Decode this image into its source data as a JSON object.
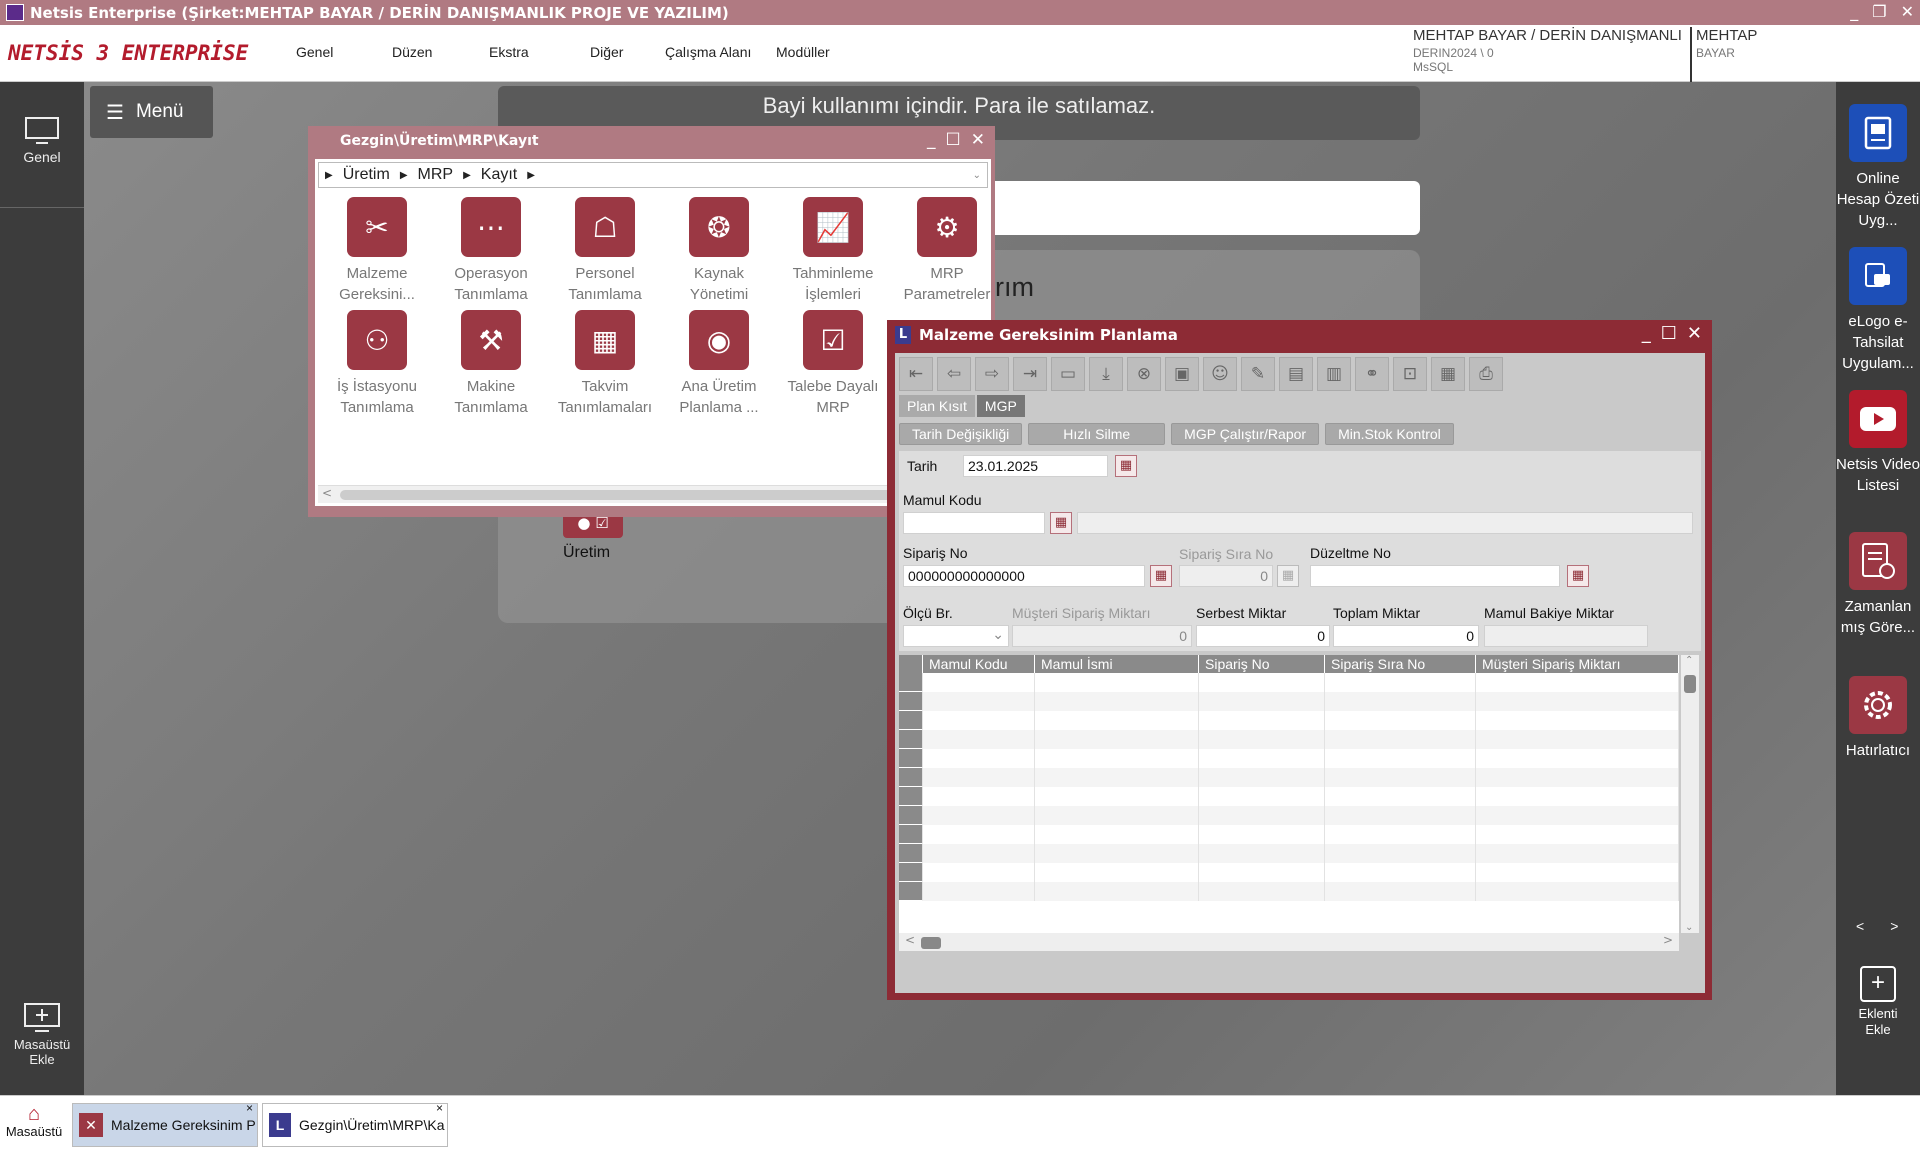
{
  "window": {
    "title": "Netsis Enterprise (Şirket:MEHTAP BAYAR / DERİN DANIŞMANLIK PROJE VE YAZILIM)",
    "minimize": "_",
    "maximize": "❐",
    "close": "✕"
  },
  "logo": {
    "prefix": "logo",
    "text": "NETSİS 3 ENTERPRİSE"
  },
  "menu": {
    "items": [
      {
        "label": "Genel"
      },
      {
        "label": "Düzen"
      },
      {
        "label": "Ekstra"
      },
      {
        "label": "Diğer"
      },
      {
        "label": "Çalışma Alanı"
      },
      {
        "label": "Modüller"
      }
    ]
  },
  "user": {
    "company": "MEHTAP BAYAR / DERİN DANIŞMANLI",
    "db": "DERIN2024 \\ 0",
    "server": "MsSQL",
    "name": "MEHTAP",
    "surname": "BAYAR"
  },
  "left_sidebar": {
    "genel": "Genel",
    "masaustu_ekle": "Masaüstü Ekle"
  },
  "desktop": {
    "menu_button": "Menü",
    "banner": "Bayi kullanımı içindir. Para ile satılamaz.",
    "partial_text": "rım",
    "uretim_label": "Üretim"
  },
  "right_sidebar": {
    "items": [
      {
        "label": "Online Hesap Özeti Uyg..."
      },
      {
        "label": "eLogo e-Tahsilat Uygulam..."
      },
      {
        "label": "Netsis Video Listesi"
      },
      {
        "label": "Zamanlan mış Göre..."
      },
      {
        "label": "Hatırlatıcı"
      }
    ],
    "nav_prev": "<",
    "nav_next": ">",
    "ekle": "Eklenti Ekle"
  },
  "gezgin": {
    "title": "Gezgin\\Üretim\\MRP\\Kayıt",
    "breadcrumb": [
      "Üretim",
      "MRP",
      "Kayıt"
    ],
    "tiles": [
      {
        "label": "Malzeme Gereksini...",
        "icon": "tools-icon"
      },
      {
        "label": "Operasyon Tanımlama",
        "icon": "operation-icon"
      },
      {
        "label": "Personel Tanımlama",
        "icon": "personnel-icon"
      },
      {
        "label": "Kaynak Yönetimi",
        "icon": "resource-icon"
      },
      {
        "label": "Tahminleme İşlemleri",
        "icon": "chart-icon"
      },
      {
        "label": "MRP Parametreler",
        "icon": "settings-doc-icon"
      },
      {
        "label": "İş İstasyonu Tanımlama",
        "icon": "workstation-icon"
      },
      {
        "label": "Makine Tanımlama",
        "icon": "machine-icon"
      },
      {
        "label": "Takvim Tanımlamaları",
        "icon": "calendar-icon"
      },
      {
        "label": "Ana Üretim Planlama ...",
        "icon": "gauge-icon"
      },
      {
        "label": "Talebe Dayalı MRP",
        "icon": "checklist-icon"
      }
    ]
  },
  "mgp": {
    "title": "Malzeme Gereksinim Planlama",
    "tabs": [
      "Plan Kısıt",
      "MGP"
    ],
    "buttons": [
      "Tarih Değişikliği",
      "Hızlı Silme",
      "MGP Çalıştır/Rapor",
      "Min.Stok Kontrol"
    ],
    "fields": {
      "tarih_label": "Tarih",
      "tarih_value": "23.01.2025",
      "mamul_kodu_label": "Mamul Kodu",
      "mamul_kodu_value": "",
      "siparis_no_label": "Sipariş No",
      "siparis_no_value": "000000000000000",
      "siparis_sira_label": "Sipariş Sıra No",
      "siparis_sira_value": "0",
      "duzeltme_label": "Düzeltme No",
      "duzeltme_value": "",
      "olcu_label": "Ölçü Br.",
      "olcu_value": "",
      "musteri_label": "Müşteri Sipariş Miktarı",
      "musteri_value": "0",
      "serbest_label": "Serbest Miktar",
      "serbest_value": "0",
      "toplam_label": "Toplam Miktar",
      "toplam_value": "0",
      "bakiye_label": "Mamul Bakiye Miktar",
      "bakiye_value": ""
    },
    "grid_columns": [
      "Mamul Kodu",
      "Mamul İsmi",
      "Sipariş No",
      "Sipariş Sıra No",
      "Müşteri Sipariş Miktarı"
    ],
    "grid_row_count": 12
  },
  "taskbar": {
    "home_label": "Masaüstü",
    "tasks": [
      {
        "label": "Malzeme Gereksinim P"
      },
      {
        "label": "Gezgin\\Üretim\\MRP\\Ka"
      }
    ],
    "close_glyph": "×"
  },
  "colors": {
    "accent": "#8d2b35",
    "tile": "#9b3844",
    "titlebar": "#b07a82"
  }
}
